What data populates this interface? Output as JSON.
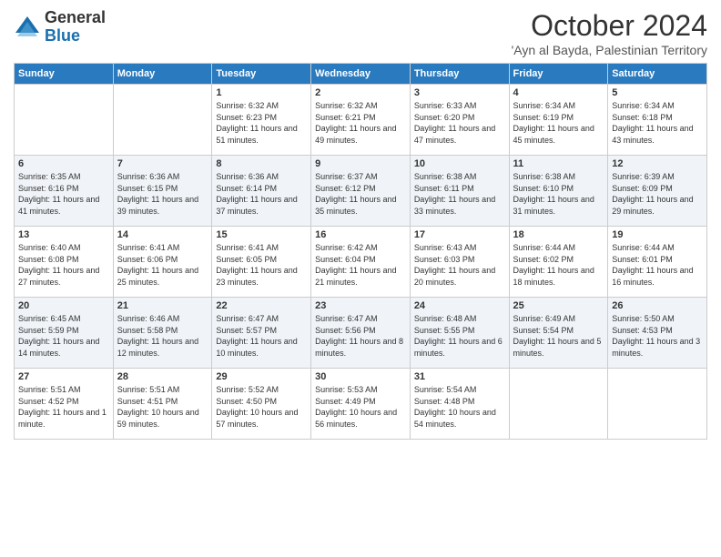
{
  "logo": {
    "general": "General",
    "blue": "Blue"
  },
  "title": "October 2024",
  "subtitle": "'Ayn al Bayda, Palestinian Territory",
  "days_of_week": [
    "Sunday",
    "Monday",
    "Tuesday",
    "Wednesday",
    "Thursday",
    "Friday",
    "Saturday"
  ],
  "weeks": [
    [
      {
        "day": "",
        "sunrise": "",
        "sunset": "",
        "daylight": ""
      },
      {
        "day": "",
        "sunrise": "",
        "sunset": "",
        "daylight": ""
      },
      {
        "day": "1",
        "sunrise": "Sunrise: 6:32 AM",
        "sunset": "Sunset: 6:23 PM",
        "daylight": "Daylight: 11 hours and 51 minutes."
      },
      {
        "day": "2",
        "sunrise": "Sunrise: 6:32 AM",
        "sunset": "Sunset: 6:21 PM",
        "daylight": "Daylight: 11 hours and 49 minutes."
      },
      {
        "day": "3",
        "sunrise": "Sunrise: 6:33 AM",
        "sunset": "Sunset: 6:20 PM",
        "daylight": "Daylight: 11 hours and 47 minutes."
      },
      {
        "day": "4",
        "sunrise": "Sunrise: 6:34 AM",
        "sunset": "Sunset: 6:19 PM",
        "daylight": "Daylight: 11 hours and 45 minutes."
      },
      {
        "day": "5",
        "sunrise": "Sunrise: 6:34 AM",
        "sunset": "Sunset: 6:18 PM",
        "daylight": "Daylight: 11 hours and 43 minutes."
      }
    ],
    [
      {
        "day": "6",
        "sunrise": "Sunrise: 6:35 AM",
        "sunset": "Sunset: 6:16 PM",
        "daylight": "Daylight: 11 hours and 41 minutes."
      },
      {
        "day": "7",
        "sunrise": "Sunrise: 6:36 AM",
        "sunset": "Sunset: 6:15 PM",
        "daylight": "Daylight: 11 hours and 39 minutes."
      },
      {
        "day": "8",
        "sunrise": "Sunrise: 6:36 AM",
        "sunset": "Sunset: 6:14 PM",
        "daylight": "Daylight: 11 hours and 37 minutes."
      },
      {
        "day": "9",
        "sunrise": "Sunrise: 6:37 AM",
        "sunset": "Sunset: 6:12 PM",
        "daylight": "Daylight: 11 hours and 35 minutes."
      },
      {
        "day": "10",
        "sunrise": "Sunrise: 6:38 AM",
        "sunset": "Sunset: 6:11 PM",
        "daylight": "Daylight: 11 hours and 33 minutes."
      },
      {
        "day": "11",
        "sunrise": "Sunrise: 6:38 AM",
        "sunset": "Sunset: 6:10 PM",
        "daylight": "Daylight: 11 hours and 31 minutes."
      },
      {
        "day": "12",
        "sunrise": "Sunrise: 6:39 AM",
        "sunset": "Sunset: 6:09 PM",
        "daylight": "Daylight: 11 hours and 29 minutes."
      }
    ],
    [
      {
        "day": "13",
        "sunrise": "Sunrise: 6:40 AM",
        "sunset": "Sunset: 6:08 PM",
        "daylight": "Daylight: 11 hours and 27 minutes."
      },
      {
        "day": "14",
        "sunrise": "Sunrise: 6:41 AM",
        "sunset": "Sunset: 6:06 PM",
        "daylight": "Daylight: 11 hours and 25 minutes."
      },
      {
        "day": "15",
        "sunrise": "Sunrise: 6:41 AM",
        "sunset": "Sunset: 6:05 PM",
        "daylight": "Daylight: 11 hours and 23 minutes."
      },
      {
        "day": "16",
        "sunrise": "Sunrise: 6:42 AM",
        "sunset": "Sunset: 6:04 PM",
        "daylight": "Daylight: 11 hours and 21 minutes."
      },
      {
        "day": "17",
        "sunrise": "Sunrise: 6:43 AM",
        "sunset": "Sunset: 6:03 PM",
        "daylight": "Daylight: 11 hours and 20 minutes."
      },
      {
        "day": "18",
        "sunrise": "Sunrise: 6:44 AM",
        "sunset": "Sunset: 6:02 PM",
        "daylight": "Daylight: 11 hours and 18 minutes."
      },
      {
        "day": "19",
        "sunrise": "Sunrise: 6:44 AM",
        "sunset": "Sunset: 6:01 PM",
        "daylight": "Daylight: 11 hours and 16 minutes."
      }
    ],
    [
      {
        "day": "20",
        "sunrise": "Sunrise: 6:45 AM",
        "sunset": "Sunset: 5:59 PM",
        "daylight": "Daylight: 11 hours and 14 minutes."
      },
      {
        "day": "21",
        "sunrise": "Sunrise: 6:46 AM",
        "sunset": "Sunset: 5:58 PM",
        "daylight": "Daylight: 11 hours and 12 minutes."
      },
      {
        "day": "22",
        "sunrise": "Sunrise: 6:47 AM",
        "sunset": "Sunset: 5:57 PM",
        "daylight": "Daylight: 11 hours and 10 minutes."
      },
      {
        "day": "23",
        "sunrise": "Sunrise: 6:47 AM",
        "sunset": "Sunset: 5:56 PM",
        "daylight": "Daylight: 11 hours and 8 minutes."
      },
      {
        "day": "24",
        "sunrise": "Sunrise: 6:48 AM",
        "sunset": "Sunset: 5:55 PM",
        "daylight": "Daylight: 11 hours and 6 minutes."
      },
      {
        "day": "25",
        "sunrise": "Sunrise: 6:49 AM",
        "sunset": "Sunset: 5:54 PM",
        "daylight": "Daylight: 11 hours and 5 minutes."
      },
      {
        "day": "26",
        "sunrise": "Sunrise: 5:50 AM",
        "sunset": "Sunset: 4:53 PM",
        "daylight": "Daylight: 11 hours and 3 minutes."
      }
    ],
    [
      {
        "day": "27",
        "sunrise": "Sunrise: 5:51 AM",
        "sunset": "Sunset: 4:52 PM",
        "daylight": "Daylight: 11 hours and 1 minute."
      },
      {
        "day": "28",
        "sunrise": "Sunrise: 5:51 AM",
        "sunset": "Sunset: 4:51 PM",
        "daylight": "Daylight: 10 hours and 59 minutes."
      },
      {
        "day": "29",
        "sunrise": "Sunrise: 5:52 AM",
        "sunset": "Sunset: 4:50 PM",
        "daylight": "Daylight: 10 hours and 57 minutes."
      },
      {
        "day": "30",
        "sunrise": "Sunrise: 5:53 AM",
        "sunset": "Sunset: 4:49 PM",
        "daylight": "Daylight: 10 hours and 56 minutes."
      },
      {
        "day": "31",
        "sunrise": "Sunrise: 5:54 AM",
        "sunset": "Sunset: 4:48 PM",
        "daylight": "Daylight: 10 hours and 54 minutes."
      },
      {
        "day": "",
        "sunrise": "",
        "sunset": "",
        "daylight": ""
      },
      {
        "day": "",
        "sunrise": "",
        "sunset": "",
        "daylight": ""
      }
    ]
  ]
}
